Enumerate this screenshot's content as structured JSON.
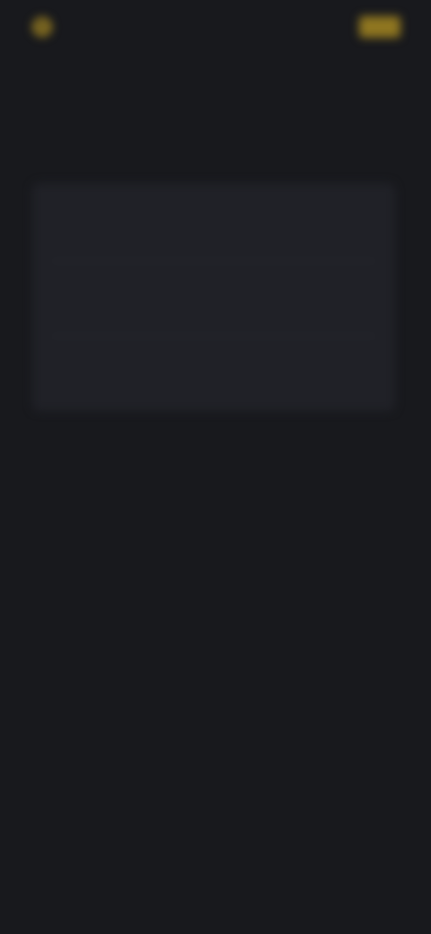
{
  "topbar": {
    "brand_mark": "B",
    "brand_name": "",
    "nav_link": "",
    "action_button": ""
  },
  "page": {
    "title": ""
  },
  "options": [
    {
      "label": "",
      "value": ""
    },
    {
      "label": "",
      "value": ""
    },
    {
      "label": "",
      "value": ""
    }
  ],
  "colors": {
    "background": "#18191d",
    "panel": "#202127",
    "accent": "#8f7620",
    "text_primary": "#d8d9dc",
    "text_secondary": "#b5b7bc"
  }
}
